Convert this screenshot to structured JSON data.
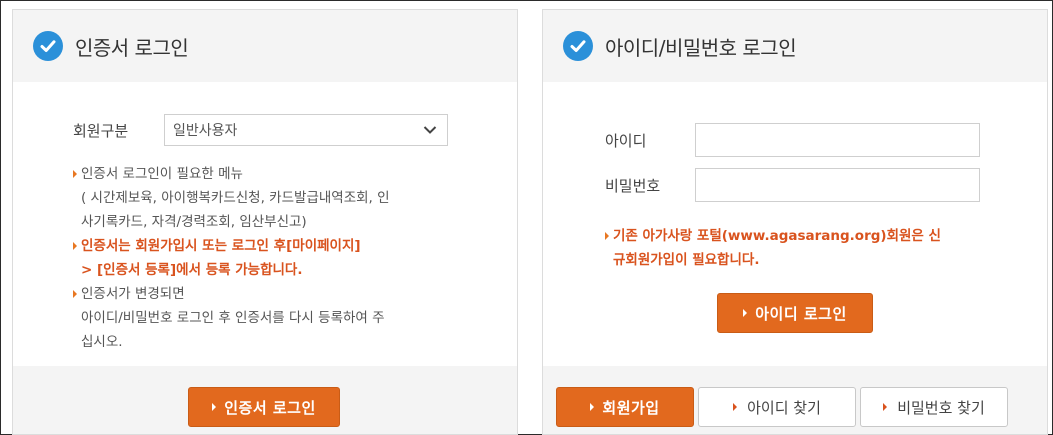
{
  "cert_panel": {
    "title": "인증서 로그인",
    "member_type_label": "회원구분",
    "member_type_selected": "일반사용자",
    "notes": {
      "line1": "인증서 로그인이 필요한 메뉴",
      "line2": "( 시간제보육, 아이행복카드신청, 카드발급내역조회, 인",
      "line3": "사기록카드, 자격/경력조회, 임산부신고)",
      "line4": "인증서는 회원가입시 또는 로그인 후[마이페이지]",
      "line5": "> [인증서 등록]에서 등록 가능합니다.",
      "line6": "인증서가 변경되면",
      "line7": "아이디/비밀번호 로그인 후 인증서를 다시 등록하여 주",
      "line8": "십시오."
    },
    "login_button": "인증서 로그인"
  },
  "id_panel": {
    "title": "아이디/비밀번호 로그인",
    "id_label": "아이디",
    "id_value": "",
    "pw_label": "비밀번호",
    "pw_value": "",
    "notice_line1": "기존 아가사랑 포털(www.agasarang.org)회원은 신",
    "notice_line2": "규회원가입이 필요합니다.",
    "login_button": "아이디 로그인",
    "join_button": "회원가입",
    "find_id_button": "아이디 찾기",
    "find_pw_button": "비밀번호 찾기"
  },
  "colors": {
    "accent_orange": "#e2691e",
    "notice_red": "#d9531e",
    "check_blue": "#2b90d9",
    "header_gray": "#f4f4f4"
  },
  "icons": {
    "header_check": "check-circle-icon",
    "select_chevron": "chevron-down-icon",
    "bullet": "triangle-bullet-icon"
  }
}
